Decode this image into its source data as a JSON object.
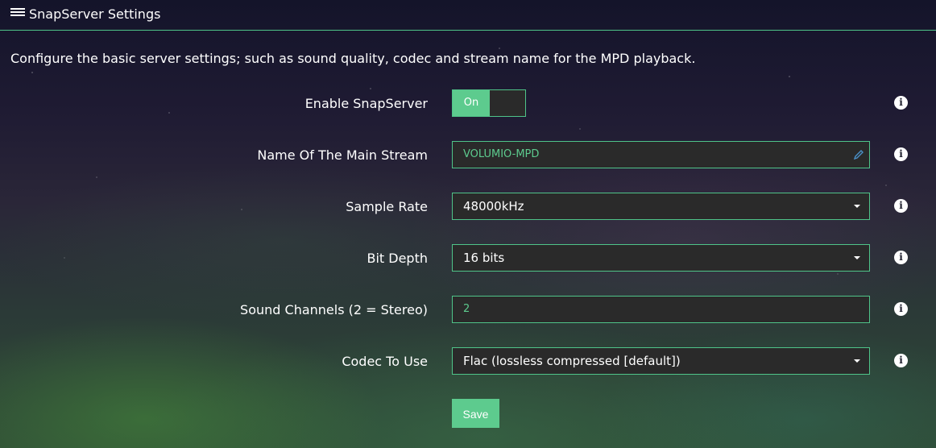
{
  "header": {
    "icon": "server-icon",
    "title": "SnapServer Settings"
  },
  "description": "Configure the basic server settings; such as sound quality, codec and stream name for the MPD playback.",
  "settings": {
    "enable": {
      "label": "Enable SnapServer",
      "state": "On",
      "on": true
    },
    "stream_name": {
      "label": "Name Of The Main Stream",
      "value": "VOLUMIO-MPD"
    },
    "sample_rate": {
      "label": "Sample Rate",
      "value": "48000kHz"
    },
    "bit_depth": {
      "label": "Bit Depth",
      "value": "16 bits"
    },
    "channels": {
      "label": "Sound Channels (2 = Stereo)",
      "value": "2"
    },
    "codec": {
      "label": "Codec To Use",
      "value": "Flac (lossless compressed [default])"
    }
  },
  "info_icon": "info-icon",
  "save_label": "Save",
  "colors": {
    "accent": "#5dcb8e",
    "border": "#4fc489",
    "field_bg": "#2a2a2a"
  }
}
